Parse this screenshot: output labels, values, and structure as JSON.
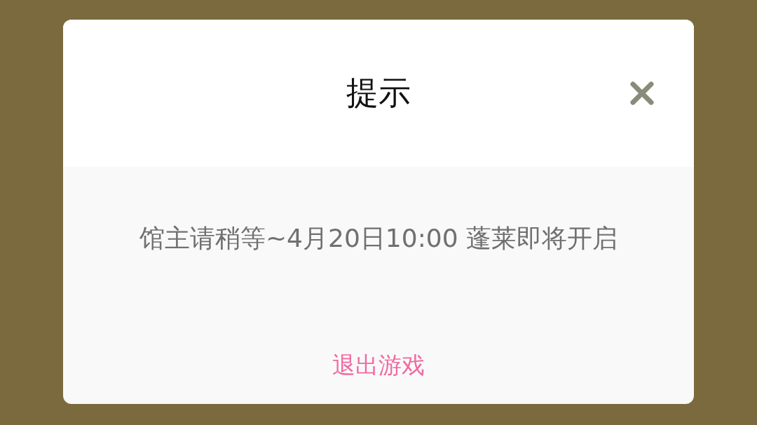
{
  "dialog": {
    "title": "提示",
    "message": "馆主请稍等~4月20日10:00 蓬莱即将开启",
    "action": "退出游戏"
  }
}
